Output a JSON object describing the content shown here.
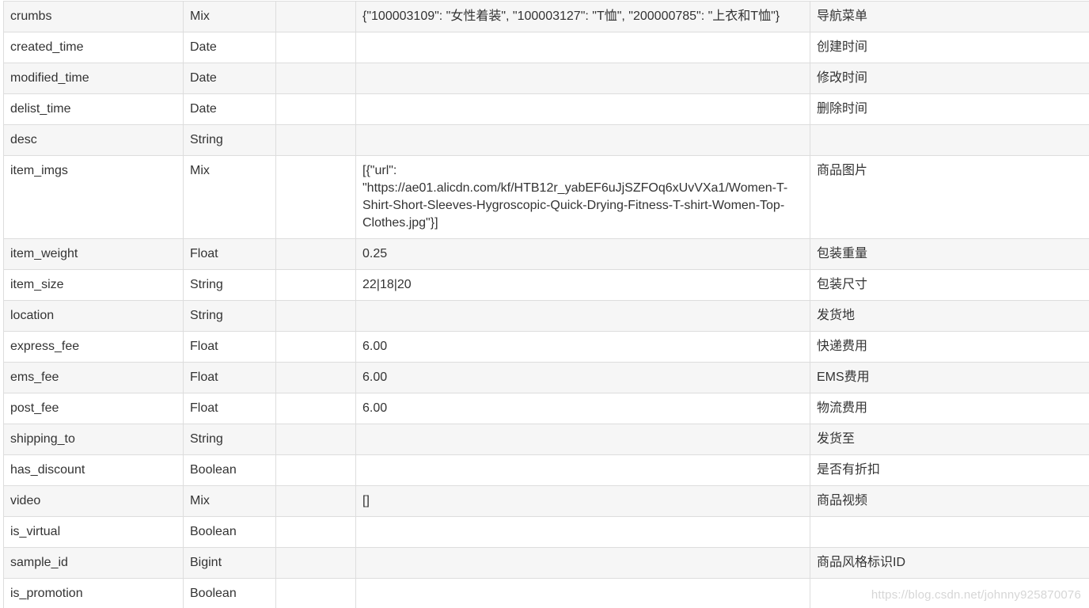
{
  "table": {
    "rows": [
      {
        "name": "crumbs",
        "type": "Mix",
        "blank": "",
        "value": "{\"100003109\": \"女性着装\", \"100003127\": \"T恤\", \"200000785\": \"上衣和T恤\"}",
        "desc": "导航菜单"
      },
      {
        "name": "created_time",
        "type": "Date",
        "blank": "",
        "value": "",
        "desc": "创建时间"
      },
      {
        "name": "modified_time",
        "type": "Date",
        "blank": "",
        "value": "",
        "desc": "修改时间"
      },
      {
        "name": "delist_time",
        "type": "Date",
        "blank": "",
        "value": "",
        "desc": "删除时间"
      },
      {
        "name": "desc",
        "type": "String",
        "blank": "",
        "value": "",
        "desc": ""
      },
      {
        "name": "item_imgs",
        "type": "Mix",
        "blank": "",
        "value": "[{\"url\": \"https://ae01.alicdn.com/kf/HTB12r_yabEF6uJjSZFOq6xUvVXa1/Women-T-Shirt-Short-Sleeves-Hygroscopic-Quick-Drying-Fitness-T-shirt-Women-Top-Clothes.jpg\"}]",
        "desc": "商品图片"
      },
      {
        "name": "item_weight",
        "type": "Float",
        "blank": "",
        "value": "0.25",
        "desc": "包装重量"
      },
      {
        "name": "item_size",
        "type": "String",
        "blank": "",
        "value": "22|18|20",
        "desc": "包装尺寸"
      },
      {
        "name": "location",
        "type": "String",
        "blank": "",
        "value": "",
        "desc": "发货地"
      },
      {
        "name": "express_fee",
        "type": "Float",
        "blank": "",
        "value": "6.00",
        "desc": "快递费用"
      },
      {
        "name": "ems_fee",
        "type": "Float",
        "blank": "",
        "value": "6.00",
        "desc": "EMS费用"
      },
      {
        "name": "post_fee",
        "type": "Float",
        "blank": "",
        "value": "6.00",
        "desc": "物流费用"
      },
      {
        "name": "shipping_to",
        "type": "String",
        "blank": "",
        "value": "",
        "desc": "发货至"
      },
      {
        "name": "has_discount",
        "type": "Boolean",
        "blank": "",
        "value": "",
        "desc": "是否有折扣"
      },
      {
        "name": "video",
        "type": "Mix",
        "blank": "",
        "value": "[]",
        "desc": "商品视频"
      },
      {
        "name": "is_virtual",
        "type": "Boolean",
        "blank": "",
        "value": "",
        "desc": ""
      },
      {
        "name": "sample_id",
        "type": "Bigint",
        "blank": "",
        "value": "",
        "desc": "商品风格标识ID"
      },
      {
        "name": "is_promotion",
        "type": "Boolean",
        "blank": "",
        "value": "",
        "desc": ""
      }
    ]
  },
  "watermark": "https://blog.csdn.net/johnny925870076"
}
